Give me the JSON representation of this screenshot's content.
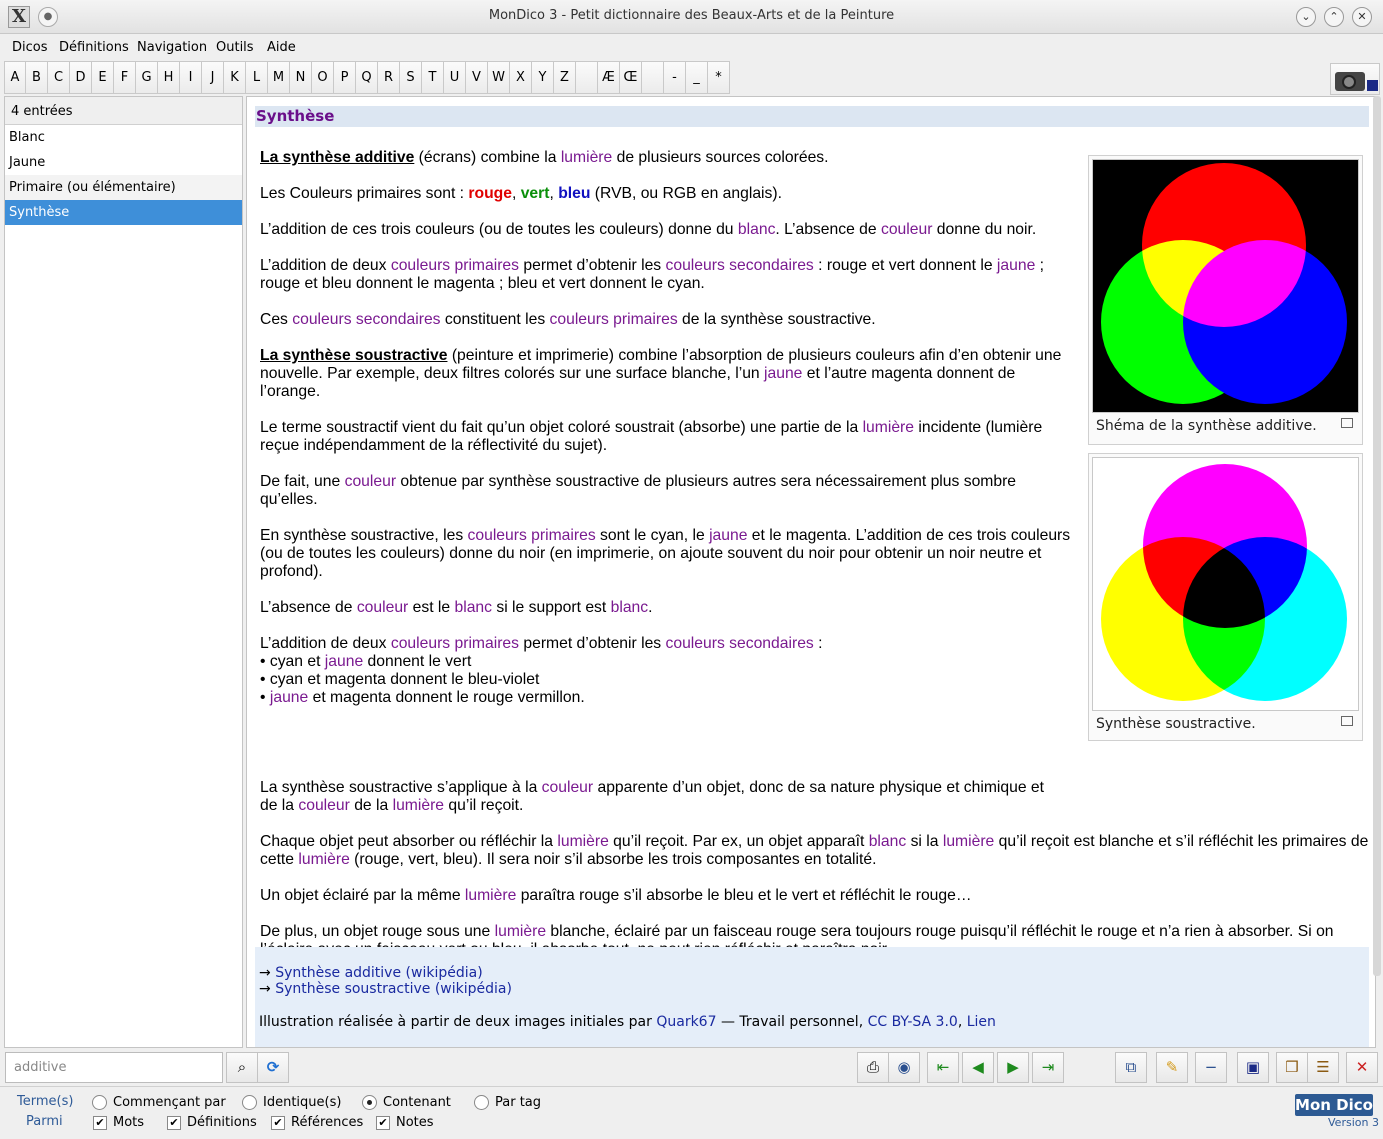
{
  "window": {
    "title": "MonDico 3 - Petit dictionnaire des Beaux-Arts et de la Peinture"
  },
  "menu": [
    "Dicos",
    "Définitions",
    "Navigation",
    "Outils",
    "Aide"
  ],
  "alphabet": [
    "A",
    "B",
    "C",
    "D",
    "E",
    "F",
    "G",
    "H",
    "I",
    "J",
    "K",
    "L",
    "M",
    "N",
    "O",
    "P",
    "Q",
    "R",
    "S",
    "T",
    "U",
    "V",
    "W",
    "X",
    "Y",
    "Z",
    "",
    "Æ",
    "Œ",
    "",
    "-",
    "_",
    "*"
  ],
  "list": {
    "count": "4 entrées",
    "items": [
      "Blanc",
      "Jaune",
      "Primaire (ou élémentaire)",
      "Synthèse"
    ],
    "selected": "Synthèse"
  },
  "article": {
    "heading": "Synthèse",
    "p1_bold": "La synthèse additive",
    "p1_a": " (écrans) combine la ",
    "p1_link": "lumière",
    "p1_b": " de plusieurs sources colorées.",
    "p2_a": "Les Couleurs primaires sont : ",
    "p2_red": "rouge",
    "p2_sep1": ", ",
    "p2_green": "vert",
    "p2_sep2": ", ",
    "p2_blue": "bleu",
    "p2_b": " (RVB, ou RGB en anglais).",
    "p3_a": "L’addition de ces trois couleurs (ou de toutes les couleurs) donne du ",
    "p3_l1": "blanc",
    "p3_b": ". L’absence de ",
    "p3_l2": "couleur",
    "p3_c": " donne du noir.",
    "p4_a": "L’addition de deux ",
    "p4_l1": "couleurs primaires",
    "p4_b": " permet d’obtenir les ",
    "p4_l2": "couleurs secondaires",
    "p4_c": " : rouge et vert donnent le ",
    "p4_l3": "jaune",
    "p4_d": " ; rouge et bleu donnent le magenta ; bleu et vert donnent le cyan.",
    "p5_a": "Ces ",
    "p5_l1": "couleurs secondaires",
    "p5_b": " constituent les ",
    "p5_l2": "couleurs primaires",
    "p5_c": " de la synthèse soustractive.",
    "p6_bold": "La synthèse soustractive",
    "p6_a": " (peinture et imprimerie) combine l’absorption de plusieurs couleurs afin d’en obtenir une nouvelle. Par exemple, deux filtres colorés sur une surface blanche, l’un ",
    "p6_l1": "jaune",
    "p6_b": " et l’autre magenta donnent de l’orange.",
    "p7_a": "Le terme soustractif vient du fait qu’un objet coloré soustrait (absorbe) une partie de la ",
    "p7_l1": "lumière",
    "p7_b": " incidente (lumière reçue indépendamment de la réflectivité du sujet).",
    "p8_a": "De fait, une ",
    "p8_l1": "couleur",
    "p8_b": " obtenue par synthèse soustractive de plusieurs autres sera nécessairement plus sombre qu’elles.",
    "p9_a": "En synthèse soustractive, les ",
    "p9_l1": "couleurs primaires",
    "p9_b": " sont le cyan, le ",
    "p9_l2": "jaune",
    "p9_c": " et le magenta. L’addition de ces trois couleurs (ou de toutes les couleurs) donne du noir (en imprimerie, on ajoute souvent du noir pour obtenir un noir neutre et profond).",
    "p10_a": "L’absence de ",
    "p10_l1": "couleur",
    "p10_b": " est le ",
    "p10_l2": "blanc",
    "p10_c": " si le support est ",
    "p10_l3": "blanc",
    "p10_d": ".",
    "p11_a": "L’addition de deux ",
    "p11_l1": "couleurs primaires",
    "p11_b": " permet d’obtenir les ",
    "p11_l2": "couleurs secondaires",
    "p11_c": " :",
    "b1_a": "• cyan et ",
    "b1_l": "jaune",
    "b1_b": " donnent le vert",
    "b2": "• cyan et magenta donnent le bleu-violet",
    "b3_a": "• ",
    "b3_l": "jaune",
    "b3_b": " et magenta donnent le rouge vermillon.",
    "p12_a": "La synthèse soustractive s’applique à la ",
    "p12_l1": "couleur",
    "p12_b": " apparente d’un objet, donc de sa nature physique et chimique et de la ",
    "p12_l2": "couleur",
    "p12_c": " de la ",
    "p12_l3": "lumière",
    "p12_d": " qu’il reçoit.",
    "p13_a": "Chaque objet peut absorber ou réfléchir la ",
    "p13_l1": "lumière",
    "p13_b": " qu’il reçoit. Par ex, un objet apparaît ",
    "p13_l2": "blanc",
    "p13_c": " si la ",
    "p13_l3": "lumière",
    "p13_d": " qu’il reçoit est blanche et s’il réfléchit les primaires de cette ",
    "p13_l4": "lumière",
    "p13_e": " (rouge, vert, bleu). Il sera noir s’il absorbe les trois composantes en totalité.",
    "p14_a": "Un objet éclairé par la même ",
    "p14_l1": "lumière",
    "p14_b": " paraîtra rouge s’il absorbe le bleu et le vert et réfléchit le rouge…",
    "p15_a": "De plus, un objet rouge sous une ",
    "p15_l1": "lumière",
    "p15_b": " blanche, éclairé par un faisceau rouge sera toujours rouge puisqu’il réfléchit le rouge et n’a rien à absorber. Si on l’éclaire avec un faisceau vert ou bleu, il absorbe tout, ne peut rien réfléchir et paraîtra noir.",
    "fig1_caption": "Shéma de la synthèse additive.",
    "fig2_caption": "Synthèse soustractive.",
    "link1_arrow": "→ ",
    "link1": "Synthèse additive (wikipédia)",
    "link2_arrow": "→ ",
    "link2": "Synthèse soustractive (wikipédia)",
    "credit_a": "Illustration réalisée à partir de deux images initiales par ",
    "credit_l1": "Quark67",
    "credit_b": " — Travail personnel, ",
    "credit_l2": "CC BY-SA 3.0",
    "credit_c": ", ",
    "credit_l3": "Lien"
  },
  "search": {
    "value": "additive"
  },
  "options": {
    "terms_label": "Terme(s)",
    "among_label": "Parmi",
    "radios": [
      "Commençant par",
      "Identique(s)",
      "Contenant",
      "Par tag"
    ],
    "selected_radio": "Contenant",
    "checks": [
      "Mots",
      "Définitions",
      "Références",
      "Notes"
    ]
  },
  "brand": {
    "logo": "Mon Dico",
    "version": "Version 3"
  },
  "colors": {
    "selection": "#3e8fd9",
    "link": "#7a1a90",
    "heading_bg": "#dce6f2",
    "footer_bg": "#e5eef9"
  }
}
